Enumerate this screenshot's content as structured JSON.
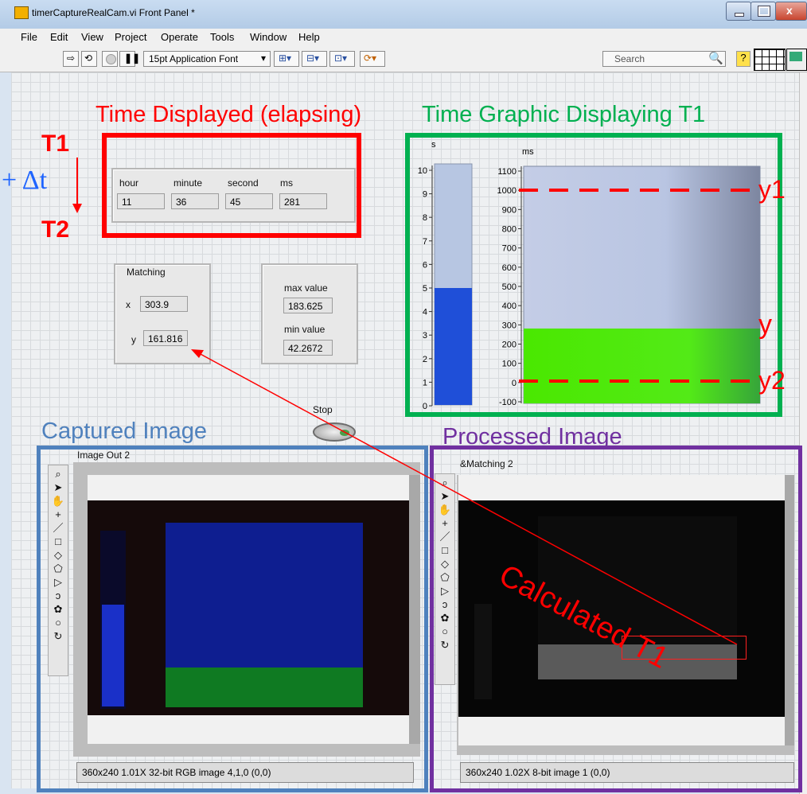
{
  "window": {
    "title": "timerCaptureRealCam.vi Front Panel *"
  },
  "menu": [
    "File",
    "Edit",
    "View",
    "Project",
    "Operate",
    "Tools",
    "Window",
    "Help"
  ],
  "toolbar": {
    "font": "15pt Application Font",
    "search_placeholder": "Search"
  },
  "annotations": {
    "time_displayed": "Time Displayed (elapsing)",
    "time_graphic": "Time Graphic Displaying T1",
    "t1": "T1",
    "t2": "T2",
    "delta": "+ Δt",
    "y1": "y1",
    "y": "y",
    "y2": "y2",
    "captured": "Captured Image",
    "processed": "Processed Image",
    "calculated": "Calculated T1"
  },
  "time": {
    "headers": [
      "hour",
      "minute",
      "second",
      "ms"
    ],
    "values": [
      "11",
      "36",
      "45",
      "281"
    ]
  },
  "matching": {
    "title": "Matching",
    "x_label": "x",
    "x": "303.9",
    "y_label": "y",
    "y": "161.816"
  },
  "stats": {
    "max_label": "max value",
    "max": "183.625",
    "min_label": "min value",
    "min": "42.2672"
  },
  "stop_label": "Stop",
  "gauges": {
    "seconds": {
      "unit": "s",
      "ticks": [
        "10",
        "9",
        "8",
        "7",
        "6",
        "5",
        "4",
        "3",
        "2",
        "1",
        "0"
      ],
      "value": 5,
      "min": 0,
      "max": 10
    },
    "ms": {
      "unit": "ms",
      "ticks": [
        "1100",
        "1000",
        "900",
        "800",
        "700",
        "600",
        "500",
        "400",
        "300",
        "200",
        "100",
        "0",
        "-100"
      ],
      "value": 281,
      "min": -100,
      "max": 1100
    }
  },
  "image1": {
    "title": "Image Out 2",
    "status": "360x240 1.01X 32-bit RGB image 4,1,0    (0,0)"
  },
  "image2": {
    "title": "&Matching 2",
    "status": "360x240 1.02X 8-bit image 1    (0,0)"
  },
  "colors": {
    "red": "#ff0000",
    "green": "#00b050",
    "blue": "#4f81bd",
    "purple": "#7030a0"
  }
}
